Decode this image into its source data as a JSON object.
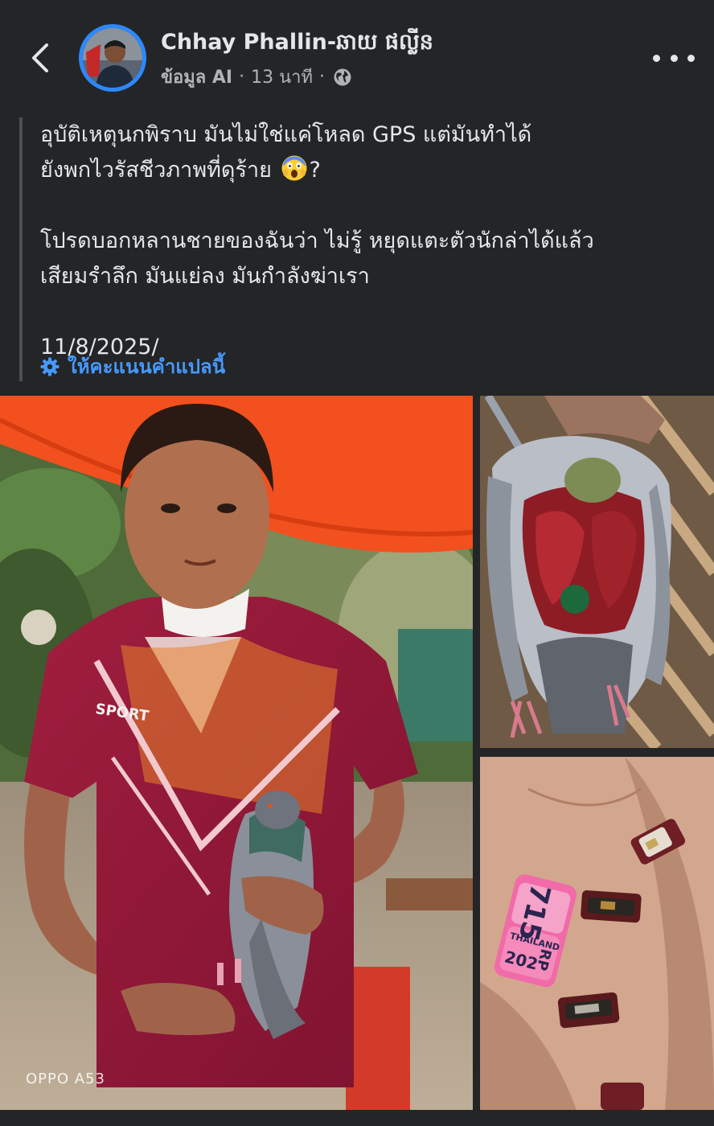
{
  "header": {
    "author_name": "Chhay Phallin-ឆាយ ផល្លីន",
    "meta_label": "ข้อมูล AI",
    "time_ago": "13 นาที",
    "separator": "·"
  },
  "post": {
    "line1": "อุบัติเหตุนกพิราบ มันไม่ใช่แค่โหลด GPS แต่มันทำได้",
    "line2_text": "ยังพกไวรัสชีวภาพที่ดุร้าย",
    "line2_suffix": "?",
    "line3": "โปรดบอกหลานชายของฉันว่า ไม่รู้ หยุดแตะตัวนักล่าได้แล้ว",
    "line4": "เสียมรำลึก มันแย่ลง มันกำลังฆ่าเรา",
    "date": "11/8/2025/",
    "rate_translation": "ให้คะแนนคำแปลนี้"
  },
  "photos": {
    "main_watermark": "OPPO A53",
    "shirt_text": "SPORT",
    "ring_number": "715",
    "ring_country": "THAILAND",
    "ring_code": "RP",
    "ring_year": "202"
  },
  "colors": {
    "background": "#242526",
    "link": "#4599ff",
    "avatar_ring": "#2d88ff",
    "text_primary": "#e4e6eb",
    "text_secondary": "#b0b3b8"
  },
  "icons": {
    "back": "chevron-left-icon",
    "more": "more-dots-icon",
    "globe": "globe-icon",
    "gear": "gear-icon",
    "emoji": "screaming-face-emoji"
  }
}
